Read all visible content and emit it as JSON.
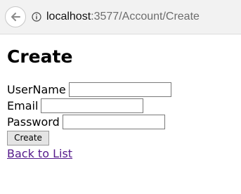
{
  "browser": {
    "url_host": "localhost",
    "url_path": ":3577/Account/Create",
    "back_icon": "back-arrow-icon",
    "info_icon": "info-icon"
  },
  "page": {
    "title": "Create",
    "fields": [
      {
        "label": "UserName",
        "value": ""
      },
      {
        "label": "Email",
        "value": ""
      },
      {
        "label": "Password",
        "value": ""
      }
    ],
    "submit_label": "Create",
    "back_link": "Back to List",
    "link_color": "#551a8b"
  }
}
